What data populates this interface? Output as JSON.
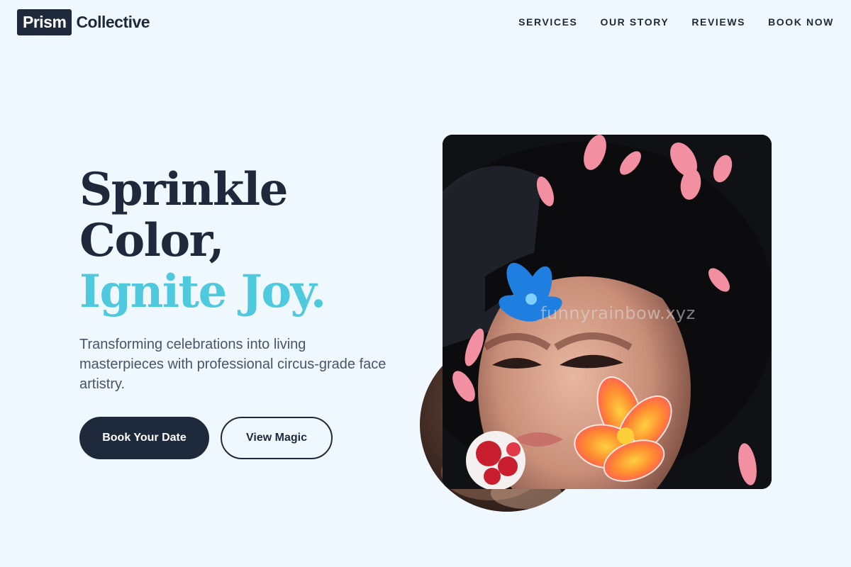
{
  "brand": {
    "name_box": "Prism",
    "name_text": "Collective"
  },
  "nav": {
    "items": [
      "SERVICES",
      "OUR STORY",
      "REVIEWS",
      "BOOK NOW"
    ]
  },
  "hero": {
    "headline_line1": "Sprinkle",
    "headline_line2": "Color,",
    "headline_line3": "Ignite Joy.",
    "subtitle": "Transforming celebrations into living masterpieces with professional circus-grade face artistry.",
    "primary_button": "Book Your Date",
    "secondary_button": "View Magic",
    "watermark": "funnyrainbow.xyz"
  },
  "colors": {
    "background": "#f0f8ff",
    "ink": "#1e293b",
    "accent": "#4ec9de",
    "muted": "#475569"
  }
}
